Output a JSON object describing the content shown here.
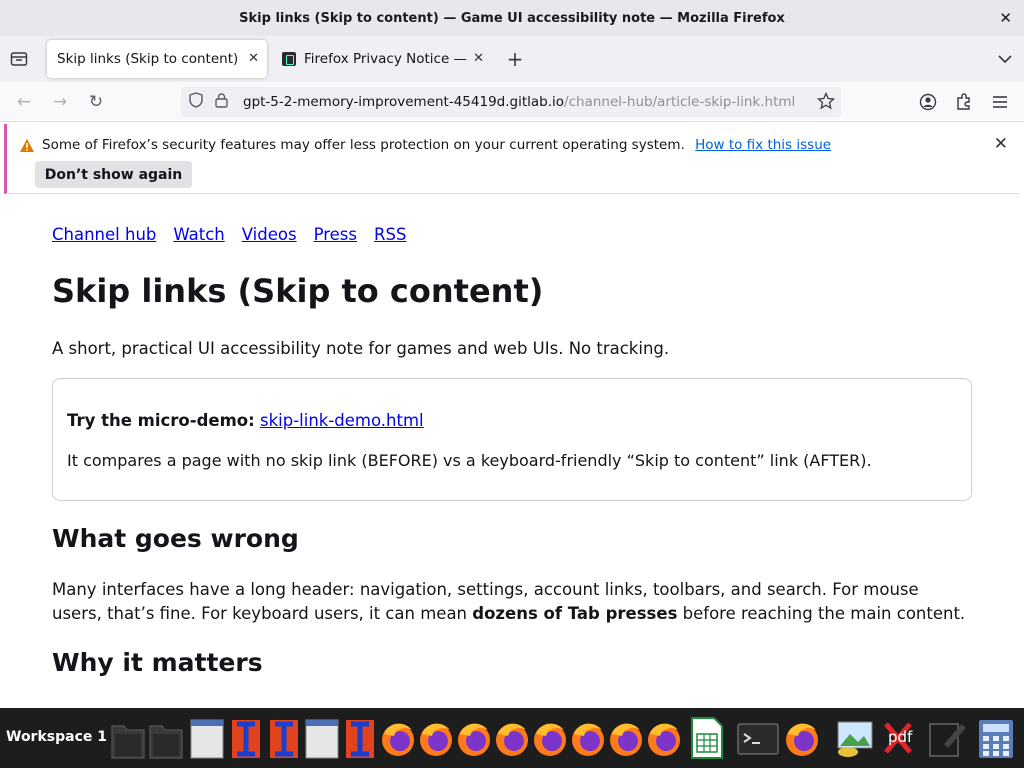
{
  "window": {
    "title": "Skip links (Skip to content) — Game UI accessibility note — Mozilla Firefox"
  },
  "tabs": [
    {
      "label": "Skip links (Skip to content) – Game UI accessibility note"
    },
    {
      "label": "Firefox Privacy Notice — Mozilla"
    }
  ],
  "urlbar": {
    "host": "gpt-5-2-memory-improvement-45419d.gitlab.io",
    "path": "/channel-hub/article-skip-link.html"
  },
  "notification": {
    "message": "Some of Firefox’s security features may offer less protection on your current operating system.",
    "link": "How to fix this issue",
    "dismiss_label": "Don’t show again"
  },
  "page": {
    "nav": [
      "Channel hub",
      "Watch",
      "Videos",
      "Press",
      "RSS"
    ],
    "title": "Skip links (Skip to content)",
    "lead": "A short, practical UI accessibility note for games and web UIs. No tracking.",
    "demo": {
      "label": "Try the micro-demo:",
      "link": "skip-link-demo.html",
      "description": "It compares a page with no skip link (BEFORE) vs a keyboard-friendly “Skip to content” link (AFTER)."
    },
    "section1": {
      "heading": "What goes wrong",
      "text_before": "Many interfaces have a long header: navigation, settings, account links, toolbars, and search. For mouse users, that’s fine. For keyboard users, it can mean ",
      "text_bold": "dozens of Tab presses",
      "text_after": " before reaching the main content."
    },
    "section2": {
      "heading": "Why it matters"
    }
  },
  "taskbar": {
    "workspace": "Workspace 1",
    "items": [
      "file-manager-icon",
      "file-manager-icon",
      "window-icon",
      "text-editor-icon",
      "text-editor-icon",
      "window-icon",
      "text-editor-icon",
      "firefox-icon",
      "firefox-icon",
      "firefox-icon",
      "firefox-icon",
      "firefox-icon",
      "firefox-icon",
      "firefox-icon",
      "firefox-icon",
      "spreadsheet-icon",
      "terminal-icon",
      "firefox-icon",
      "image-viewer-icon",
      "pdf-icon",
      "editor-icon",
      "calculator-icon"
    ],
    "pdf_label": "pdf"
  },
  "colors": {
    "link": "#0000ee",
    "chrome_link": "#0061e0",
    "accent": "#d957ab",
    "taskbar": "#1d1d1d"
  }
}
